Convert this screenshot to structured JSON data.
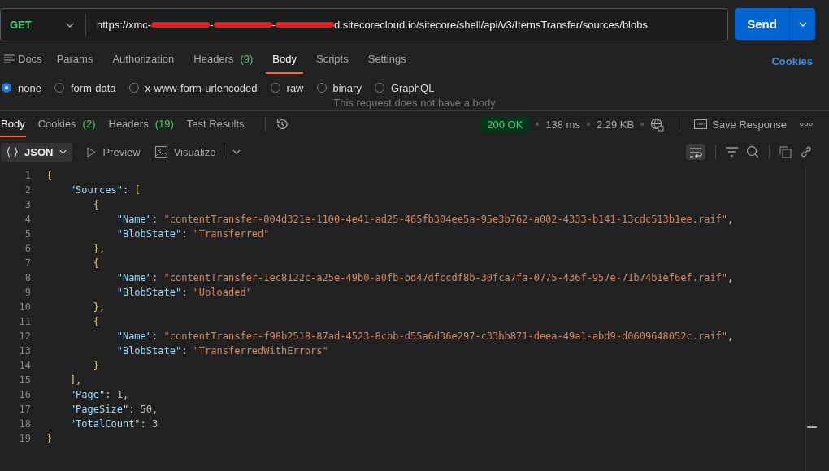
{
  "request": {
    "method": "GET",
    "url_parts": [
      {
        "kind": "text",
        "text": "https://xmc-"
      },
      {
        "kind": "redacted"
      },
      {
        "kind": "text",
        "text": "-"
      },
      {
        "kind": "redacted"
      },
      {
        "kind": "text",
        "text": "-"
      },
      {
        "kind": "redacted"
      },
      {
        "kind": "text",
        "text": "d.sitecorecloud.io/sitecore/shell/api/v3/ItemsTransfer/sources/blobs"
      }
    ],
    "send": "Send"
  },
  "request_tabs": [
    {
      "label": "Docs",
      "selected": false,
      "icon": true
    },
    {
      "label": "Params",
      "selected": false
    },
    {
      "label": "Authorization",
      "selected": false
    },
    {
      "label": "Headers",
      "count": "(9)",
      "selected": false
    },
    {
      "label": "Body",
      "selected": true
    },
    {
      "label": "Scripts",
      "selected": false
    },
    {
      "label": "Settings",
      "selected": false
    }
  ],
  "cookies_link": "Cookies",
  "body_types": [
    {
      "label": "none",
      "selected": true
    },
    {
      "label": "form-data",
      "selected": false
    },
    {
      "label": "x-www-form-urlencoded",
      "selected": false
    },
    {
      "label": "raw",
      "selected": false
    },
    {
      "label": "binary",
      "selected": false
    },
    {
      "label": "GraphQL",
      "selected": false
    }
  ],
  "empty_body_message": "This request does not have a body",
  "response_tabs": [
    {
      "label": "Body",
      "selected": true
    },
    {
      "label": "Cookies",
      "count": "(2)",
      "selected": false
    },
    {
      "label": "Headers",
      "count": "(19)",
      "selected": false
    },
    {
      "label": "Test Results",
      "selected": false
    }
  ],
  "status": {
    "code": "200 OK",
    "time": "138 ms",
    "size": "2.29 KB",
    "save": "Save Response"
  },
  "view": {
    "format": "JSON",
    "preview": "Preview",
    "visualize": "Visualize"
  },
  "code_lines": [
    {
      "number": "1",
      "tokens": [
        {
          "kind": "brace",
          "text": "{"
        }
      ]
    },
    {
      "number": "2",
      "tokens": [
        {
          "kind": "key",
          "text": "    \"Sources\""
        },
        {
          "kind": "punct",
          "text": ": "
        },
        {
          "kind": "brace",
          "text": "["
        }
      ]
    },
    {
      "number": "3",
      "tokens": [
        {
          "kind": "brace",
          "text": "        {"
        }
      ]
    },
    {
      "number": "4",
      "tokens": [
        {
          "kind": "key",
          "text": "            \"Name\""
        },
        {
          "kind": "punct",
          "text": ": "
        },
        {
          "kind": "string",
          "text": "\"contentTransfer-004d321e-1100-4e41-ad25-465fb304ee5a-95e3b762-a002-4333-b141-13cdc513b1ee.raif\""
        },
        {
          "kind": "punct",
          "text": ","
        }
      ]
    },
    {
      "number": "5",
      "tokens": [
        {
          "kind": "key",
          "text": "            \"BlobState\""
        },
        {
          "kind": "punct",
          "text": ": "
        },
        {
          "kind": "string",
          "text": "\"Transferred\""
        }
      ]
    },
    {
      "number": "6",
      "tokens": [
        {
          "kind": "brace",
          "text": "        },"
        }
      ]
    },
    {
      "number": "7",
      "tokens": [
        {
          "kind": "brace",
          "text": "        {"
        }
      ]
    },
    {
      "number": "8",
      "tokens": [
        {
          "kind": "key",
          "text": "            \"Name\""
        },
        {
          "kind": "punct",
          "text": ": "
        },
        {
          "kind": "string",
          "text": "\"contentTransfer-1ec8122c-a25e-49b0-a0fb-bd47dfccdf8b-30fca7fa-0775-436f-957e-71b74b1ef6ef.raif\""
        },
        {
          "kind": "punct",
          "text": ","
        }
      ]
    },
    {
      "number": "9",
      "tokens": [
        {
          "kind": "key",
          "text": "            \"BlobState\""
        },
        {
          "kind": "punct",
          "text": ": "
        },
        {
          "kind": "string",
          "text": "\"Uploaded\""
        }
      ]
    },
    {
      "number": "10",
      "tokens": [
        {
          "kind": "brace",
          "text": "        },"
        }
      ]
    },
    {
      "number": "11",
      "tokens": [
        {
          "kind": "brace",
          "text": "        {"
        }
      ]
    },
    {
      "number": "12",
      "tokens": [
        {
          "kind": "key",
          "text": "            \"Name\""
        },
        {
          "kind": "punct",
          "text": ": "
        },
        {
          "kind": "string",
          "text": "\"contentTransfer-f98b2518-87ad-4523-8cbb-d55a6d36e297-c33bb871-deea-49a1-abd9-d0609648052c.raif\""
        },
        {
          "kind": "punct",
          "text": ","
        }
      ]
    },
    {
      "number": "13",
      "tokens": [
        {
          "kind": "key",
          "text": "            \"BlobState\""
        },
        {
          "kind": "punct",
          "text": ": "
        },
        {
          "kind": "string",
          "text": "\"TransferredWithErrors\""
        }
      ]
    },
    {
      "number": "14",
      "tokens": [
        {
          "kind": "brace",
          "text": "        }"
        }
      ]
    },
    {
      "number": "15",
      "tokens": [
        {
          "kind": "brace",
          "text": "    ],"
        }
      ]
    },
    {
      "number": "16",
      "tokens": [
        {
          "kind": "key",
          "text": "    \"Page\""
        },
        {
          "kind": "punct",
          "text": ": "
        },
        {
          "kind": "number",
          "text": "1"
        },
        {
          "kind": "punct",
          "text": ","
        }
      ]
    },
    {
      "number": "17",
      "tokens": [
        {
          "kind": "key",
          "text": "    \"PageSize\""
        },
        {
          "kind": "punct",
          "text": ": "
        },
        {
          "kind": "number",
          "text": "50"
        },
        {
          "kind": "punct",
          "text": ","
        }
      ]
    },
    {
      "number": "18",
      "tokens": [
        {
          "kind": "key",
          "text": "    \"TotalCount\""
        },
        {
          "kind": "punct",
          "text": ": "
        },
        {
          "kind": "number",
          "text": "3"
        }
      ]
    },
    {
      "number": "19",
      "tokens": [
        {
          "kind": "brace",
          "text": "}"
        }
      ]
    }
  ]
}
